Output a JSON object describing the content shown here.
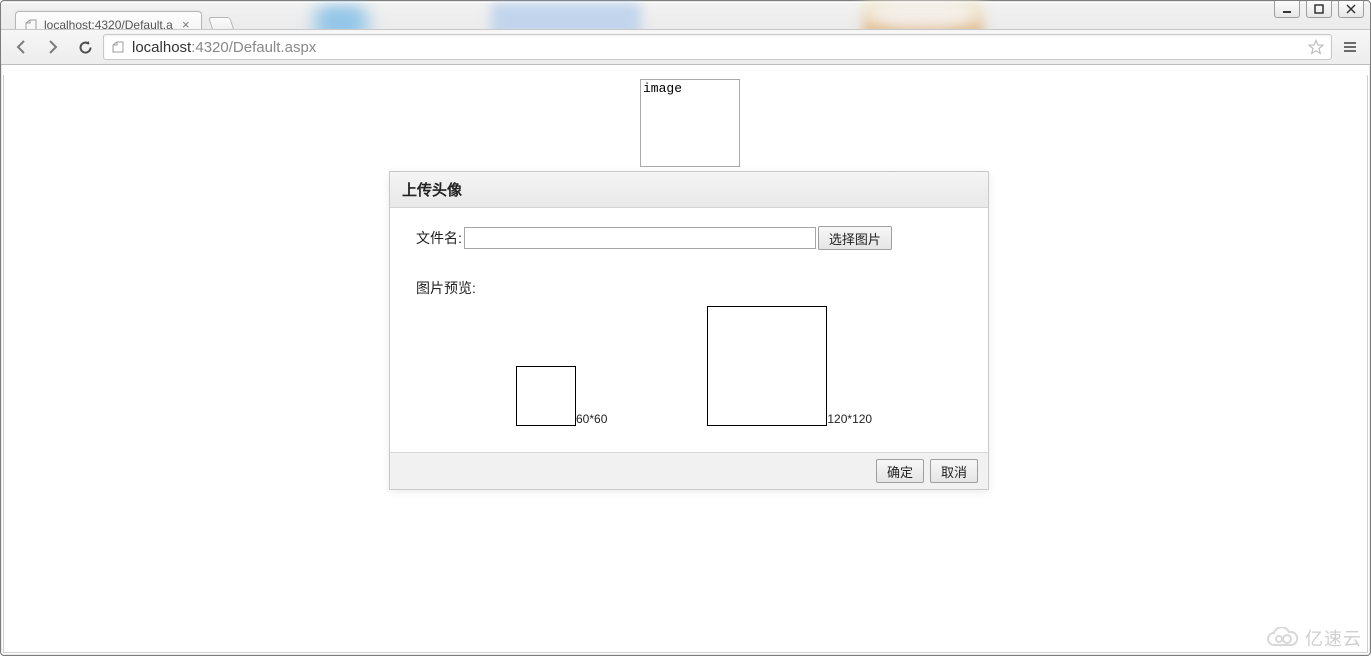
{
  "window": {
    "controls": {
      "minimize": "minimize",
      "maximize": "maximize",
      "close": "close"
    }
  },
  "browser": {
    "tab": {
      "title": "localhost:4320/Default.a",
      "close_label": "×"
    },
    "url_host": "localhost",
    "url_rest": ":4320/Default.aspx"
  },
  "page": {
    "broken_image_alt": "image"
  },
  "dialog": {
    "title": "上传头像",
    "file_label": "文件名:",
    "file_value": "",
    "choose_button": "选择图片",
    "preview_label": "图片预览:",
    "preview_60_caption": "60*60",
    "preview_120_caption": "120*120",
    "ok": "确定",
    "cancel": "取消"
  },
  "watermark": {
    "text": "亿速云"
  }
}
